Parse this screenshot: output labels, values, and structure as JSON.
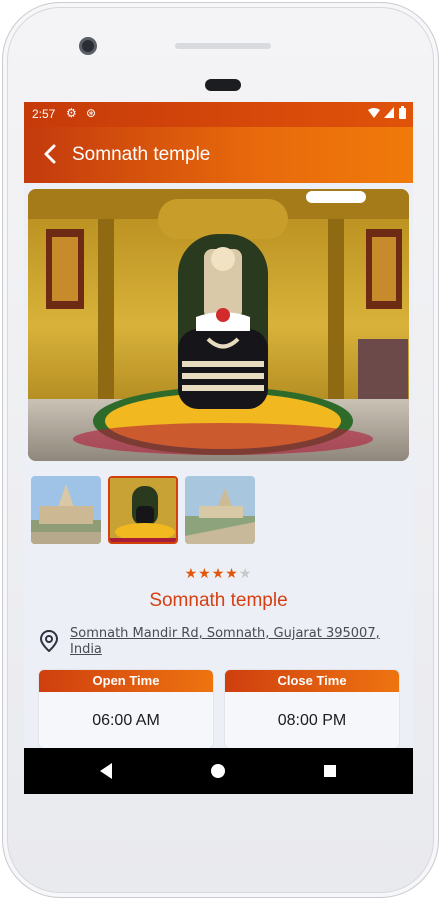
{
  "status": {
    "time": "2:57"
  },
  "appbar": {
    "title": "Somnath temple"
  },
  "place": {
    "rating": 4,
    "rating_max": 5,
    "title": "Somnath temple",
    "address_line1": "Somnath Mandir Rd, Somnath, Gujarat 395007,",
    "address_line2": "India"
  },
  "hours": {
    "open_label": "Open Time",
    "open_value": "06:00 AM",
    "close_label": "Close Time",
    "close_value": "08:00 PM"
  },
  "gallery": {
    "selected_index": 1
  },
  "colors": {
    "accent": "#e0530a",
    "title_red": "#d53f12"
  },
  "icons": [
    "settings-icon",
    "data-saver-icon",
    "wifi-icon",
    "signal-icon",
    "battery-icon",
    "back-arrow-icon",
    "location-pin-icon",
    "nav-back-icon",
    "nav-home-icon",
    "nav-recents-icon"
  ]
}
